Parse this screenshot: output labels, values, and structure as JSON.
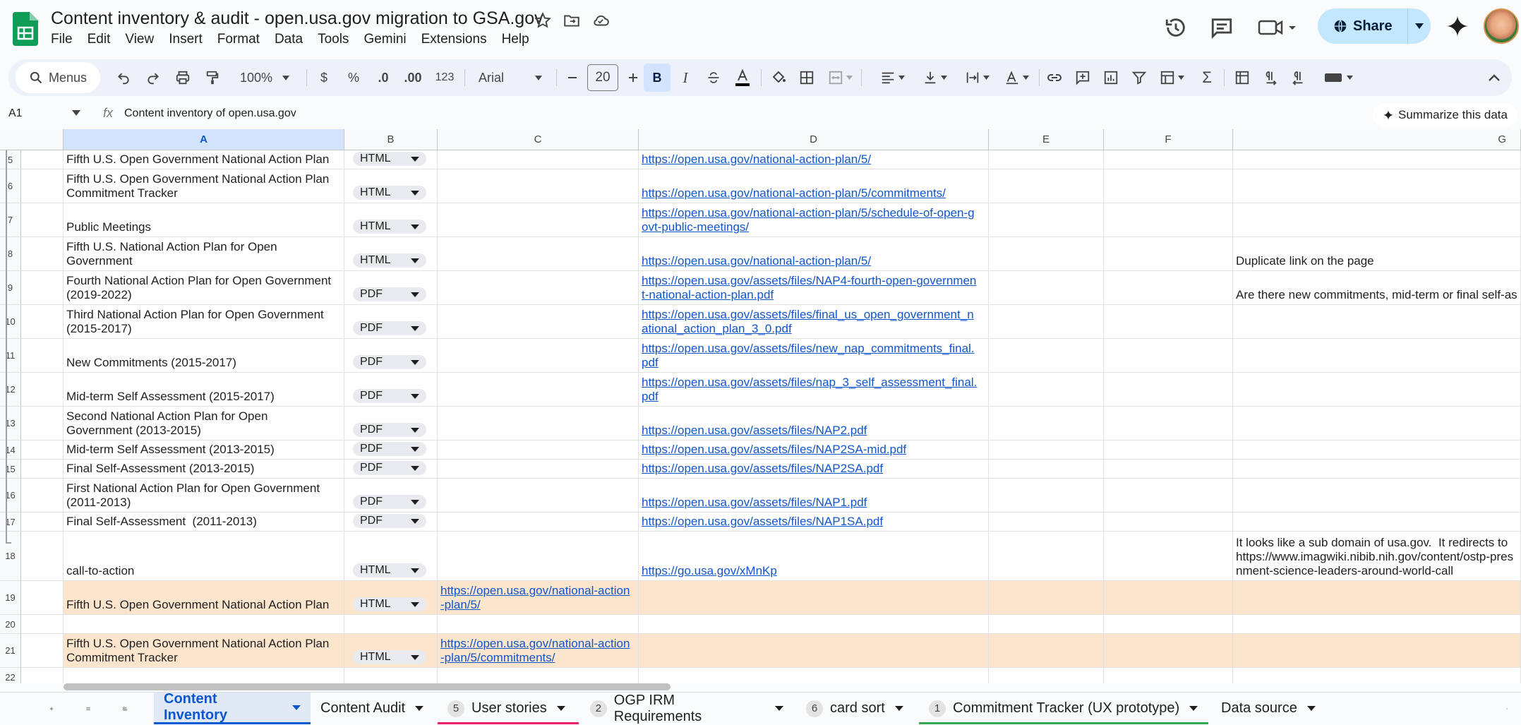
{
  "doc_title": "Content inventory & audit - open.usa.gov migration to GSA.gov",
  "menu": [
    "File",
    "Edit",
    "View",
    "Insert",
    "Format",
    "Data",
    "Tools",
    "Gemini",
    "Extensions",
    "Help"
  ],
  "share_label": "Share",
  "toolbar": {
    "menus_label": "Menus",
    "zoom": "100%",
    "currency": "$",
    "percent": "%",
    "dec_dec": ".0",
    "inc_dec": ".00",
    "number_format": "123",
    "font": "Arial",
    "font_size": "20",
    "bold": "B",
    "italic": "I",
    "sigma": "Σ"
  },
  "name_box": "A1",
  "fx": "fx",
  "formula": "Content inventory of open.usa.gov",
  "summarize_label": "Summarize this data",
  "columns": [
    "A",
    "B",
    "C",
    "D",
    "E",
    "F",
    "G"
  ],
  "rows": [
    {
      "num": "5",
      "a": "Fifth U.S. Open Government National Action Plan",
      "b": "HTML",
      "c": "",
      "d": "https://open.usa.gov/national-action-plan/5/",
      "g": "",
      "hl": false
    },
    {
      "num": "6",
      "a": "Fifth U.S. Open Government National Action Plan\nCommitment Tracker",
      "b": "HTML",
      "c": "",
      "d": "https://open.usa.gov/national-action-plan/5/commitments/",
      "g": "",
      "hl": false
    },
    {
      "num": "7",
      "a": "Public Meetings",
      "b": "HTML",
      "c": "",
      "d": "https://open.usa.gov/national-action-plan/5/schedule-of-open-g\novt-public-meetings/",
      "g": "",
      "hl": false
    },
    {
      "num": "8",
      "a": "Fifth U.S. National Action Plan for Open\nGovernment",
      "b": "HTML",
      "c": "",
      "d": "https://open.usa.gov/national-action-plan/5/",
      "g": "Duplicate link on the page",
      "hl": false
    },
    {
      "num": "9",
      "a": "Fourth National Action Plan for Open Government\n(2019-2022)",
      "b": "PDF",
      "c": "",
      "d": "https://open.usa.gov/assets/files/NAP4-fourth-open-governmen\nt-national-action-plan.pdf",
      "g": "Are there new commitments, mid-term or final self-as",
      "hl": false
    },
    {
      "num": "10",
      "a": "Third National Action Plan for Open Government\n(2015-2017)",
      "b": "PDF",
      "c": "",
      "d": "https://open.usa.gov/assets/files/final_us_open_government_n\national_action_plan_3_0.pdf",
      "g": "",
      "hl": false
    },
    {
      "num": "11",
      "a": "New Commitments (2015-2017)",
      "b": "PDF",
      "c": "",
      "d": "https://open.usa.gov/assets/files/new_nap_commitments_final.\npdf",
      "g": "",
      "hl": false
    },
    {
      "num": "12",
      "a": "Mid-term Self Assessment (2015-2017)",
      "b": "PDF",
      "c": "",
      "d": "https://open.usa.gov/assets/files/nap_3_self_assessment_final.\npdf",
      "g": "",
      "hl": false
    },
    {
      "num": "13",
      "a": "Second National Action Plan for Open\nGovernment (2013-2015)",
      "b": "PDF",
      "c": "",
      "d": "https://open.usa.gov/assets/files/NAP2.pdf",
      "g": "",
      "hl": false
    },
    {
      "num": "14",
      "a": "Mid-term Self Assessment (2013-2015)",
      "b": "PDF",
      "c": "",
      "d": "https://open.usa.gov/assets/files/NAP2SA-mid.pdf",
      "g": "",
      "hl": false
    },
    {
      "num": "15",
      "a": "Final Self-Assessment (2013-2015)",
      "b": "PDF",
      "c": "",
      "d": "https://open.usa.gov/assets/files/NAP2SA.pdf",
      "g": "",
      "hl": false
    },
    {
      "num": "16",
      "a": "First National Action Plan for Open Government\n(2011-2013)",
      "b": "PDF",
      "c": "",
      "d": "https://open.usa.gov/assets/files/NAP1.pdf",
      "g": "",
      "hl": false
    },
    {
      "num": "17",
      "a": "Final Self-Assessment  (2011-2013)",
      "b": "PDF",
      "c": "",
      "d": "https://open.usa.gov/assets/files/NAP1SA.pdf",
      "g": "",
      "hl": false
    },
    {
      "num": "18",
      "a": "call-to-action",
      "b": "HTML",
      "c": "",
      "d": "https://go.usa.gov/xMnKp",
      "g": "It looks like a sub domain of usa.gov.  It redirects to\nhttps://www.imagwiki.nibib.nih.gov/content/ostp-pres\nnment-science-leaders-around-world-call",
      "hl": false
    },
    {
      "num": "19",
      "a": "Fifth U.S. Open Government National Action Plan",
      "b": "HTML",
      "c": "https://open.usa.gov/national-action\n-plan/5/",
      "d": "",
      "g": "",
      "hl": true
    },
    {
      "num": "20",
      "a": "",
      "b": "",
      "c": "",
      "d": "",
      "g": "",
      "hl": false
    },
    {
      "num": "21",
      "a": "Fifth U.S. Open Government National Action Plan\nCommitment Tracker",
      "b": "HTML",
      "c": "https://open.usa.gov/national-action\n-plan/5/commitments/",
      "d": "",
      "g": "",
      "hl": true
    },
    {
      "num": "22",
      "a": "",
      "b": "",
      "c": "",
      "d": "",
      "g": "",
      "hl": false
    }
  ],
  "tabs": [
    {
      "label": "Content Inventory",
      "badge": "",
      "active": true,
      "color": "#0b57d0"
    },
    {
      "label": "Content Audit",
      "badge": "",
      "active": false,
      "color": ""
    },
    {
      "label": "User stories",
      "badge": "5",
      "active": false,
      "color": "#e91e63"
    },
    {
      "label": "OGP IRM Requirements",
      "badge": "2",
      "active": false,
      "color": ""
    },
    {
      "label": "card sort",
      "badge": "6",
      "active": false,
      "color": ""
    },
    {
      "label": "Commitment Tracker (UX prototype)",
      "badge": "1",
      "active": false,
      "color": "#34a853"
    },
    {
      "label": "Data source",
      "badge": "",
      "active": false,
      "color": ""
    }
  ]
}
